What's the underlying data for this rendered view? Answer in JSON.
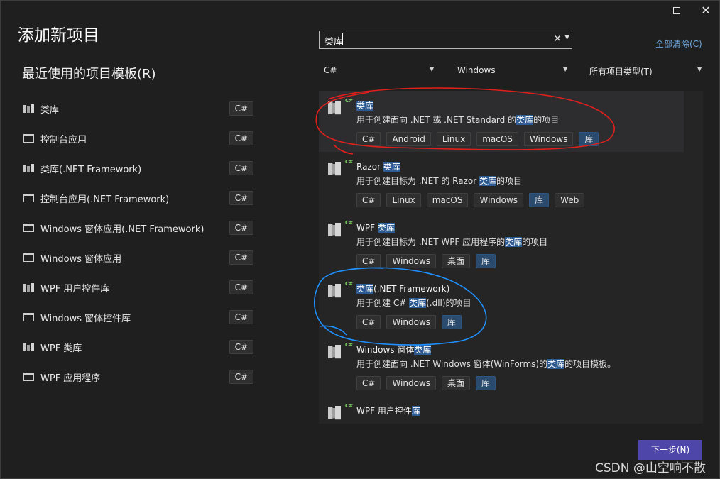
{
  "window": {
    "max_icon": "maximize-icon",
    "close_glyph": "✕"
  },
  "title": "添加新项目",
  "recent": {
    "heading": "最近使用的项目模板(R)",
    "items": [
      {
        "label": "类库",
        "tag": "C#",
        "icon": "class-library-icon"
      },
      {
        "label": "控制台应用",
        "tag": "C#",
        "icon": "console-app-icon"
      },
      {
        "label": "类库(.NET Framework)",
        "tag": "C#",
        "icon": "class-library-icon"
      },
      {
        "label": "控制台应用(.NET Framework)",
        "tag": "C#",
        "icon": "console-app-icon"
      },
      {
        "label": "Windows 窗体应用(.NET Framework)",
        "tag": "C#",
        "icon": "windows-form-icon"
      },
      {
        "label": "Windows 窗体应用",
        "tag": "C#",
        "icon": "windows-form-icon"
      },
      {
        "label": "WPF 用户控件库",
        "tag": "C#",
        "icon": "wpf-control-icon"
      },
      {
        "label": "Windows 窗体控件库",
        "tag": "C#",
        "icon": "windows-form-icon"
      },
      {
        "label": "WPF 类库",
        "tag": "C#",
        "icon": "wpf-library-icon"
      },
      {
        "label": "WPF 应用程序",
        "tag": "C#",
        "icon": "wpf-app-icon"
      }
    ]
  },
  "search": {
    "value": "类库",
    "clear_glyph": "✕",
    "dropdown_glyph": "▼"
  },
  "clear_all": "全部清除(C)",
  "filters": {
    "language": "C#",
    "platform": "Windows",
    "project_type": "所有项目类型(T)",
    "arrow_glyph": "▼"
  },
  "results": [
    {
      "title": [
        {
          "t": "类库",
          "hl": true
        }
      ],
      "desc": [
        {
          "t": "用于创建面向 .NET 或 .NET Standard 的"
        },
        {
          "t": "类库",
          "hl": true
        },
        {
          "t": "的项目"
        }
      ],
      "tags": [
        {
          "t": "C#"
        },
        {
          "t": "Android"
        },
        {
          "t": "Linux"
        },
        {
          "t": "macOS"
        },
        {
          "t": "Windows"
        },
        {
          "t": "库",
          "hl": true
        }
      ],
      "selected": true,
      "icon": "class-library-icon"
    },
    {
      "title": [
        {
          "t": "Razor "
        },
        {
          "t": "类库",
          "hl": true
        }
      ],
      "desc": [
        {
          "t": "用于创建目标为 .NET 的 Razor "
        },
        {
          "t": "类库",
          "hl": true
        },
        {
          "t": "的项目"
        }
      ],
      "tags": [
        {
          "t": "C#"
        },
        {
          "t": "Linux"
        },
        {
          "t": "macOS"
        },
        {
          "t": "Windows"
        },
        {
          "t": "库",
          "hl": true
        },
        {
          "t": "Web"
        }
      ],
      "selected": false,
      "icon": "razor-library-icon"
    },
    {
      "title": [
        {
          "t": "WPF "
        },
        {
          "t": "类库",
          "hl": true
        }
      ],
      "desc": [
        {
          "t": "用于创建目标为 .NET WPF 应用程序的"
        },
        {
          "t": "类库",
          "hl": true
        },
        {
          "t": "的项目"
        }
      ],
      "tags": [
        {
          "t": "C#"
        },
        {
          "t": "Windows"
        },
        {
          "t": "桌面"
        },
        {
          "t": "库",
          "hl": true
        }
      ],
      "selected": false,
      "icon": "wpf-library-icon"
    },
    {
      "title": [
        {
          "t": "类库",
          "hl": true
        },
        {
          "t": "(.NET Framework)"
        }
      ],
      "desc": [
        {
          "t": "用于创建 C# "
        },
        {
          "t": "类库",
          "hl": true
        },
        {
          "t": "(.dll)的项目"
        }
      ],
      "tags": [
        {
          "t": "C#"
        },
        {
          "t": "Windows"
        },
        {
          "t": "库",
          "hl": true
        }
      ],
      "selected": false,
      "icon": "class-library-icon"
    },
    {
      "title": [
        {
          "t": "Windows 窗体"
        },
        {
          "t": "类库",
          "hl": true
        }
      ],
      "desc": [
        {
          "t": "用于创建面向 .NET Windows 窗体(WinForms)的"
        },
        {
          "t": "类库",
          "hl": true
        },
        {
          "t": "的项目模板。"
        }
      ],
      "tags": [
        {
          "t": "C#"
        },
        {
          "t": "Windows"
        },
        {
          "t": "桌面"
        },
        {
          "t": "库",
          "hl": true
        }
      ],
      "selected": false,
      "icon": "windows-form-library-icon"
    },
    {
      "title": [
        {
          "t": "WPF 用户控件"
        },
        {
          "t": "库",
          "hl": true
        }
      ],
      "desc": [],
      "tags": [],
      "selected": false,
      "icon": "wpf-control-icon"
    }
  ],
  "next_button": "下一步(N)",
  "watermark": "CSDN @山空响不散",
  "colors": {
    "background": "#1f1f1f",
    "panel": "#252526",
    "highlight": "#2b5a92",
    "primary_button": "#4e46a8",
    "link": "#6fa8dc",
    "annotation_red": "#e0201b",
    "annotation_blue": "#1e90ff"
  }
}
